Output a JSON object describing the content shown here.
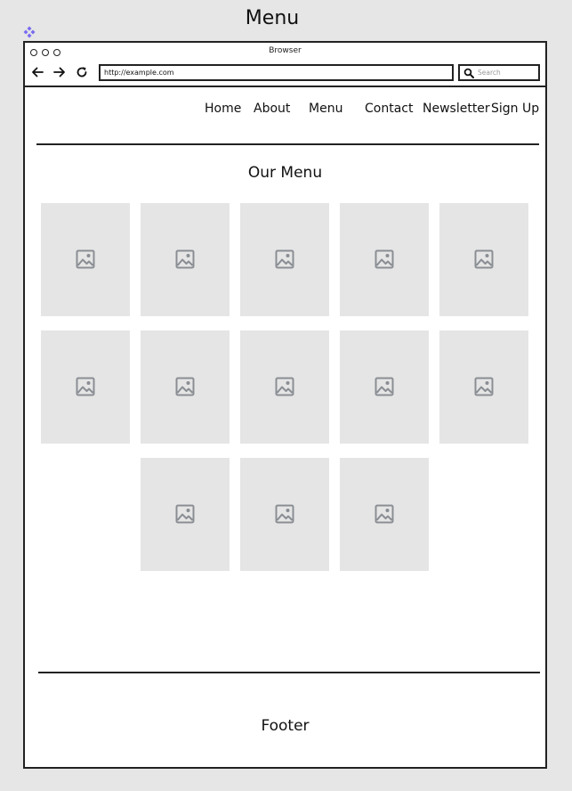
{
  "page": {
    "title": "Menu"
  },
  "browser": {
    "title": "Browser",
    "url": "http://example.com",
    "search_placeholder": "Search"
  },
  "nav": {
    "items": [
      "Home",
      "About",
      "Menu",
      "Contact",
      "Newsletter",
      "Sign Up"
    ]
  },
  "main": {
    "section_title": "Our Menu",
    "image_count": 13
  },
  "footer": {
    "label": "Footer"
  },
  "colors": {
    "background": "#e6e6e6",
    "placeholder": "#e5e5e5",
    "icon": "#8a8e94",
    "accent": "#7a6cf0"
  }
}
